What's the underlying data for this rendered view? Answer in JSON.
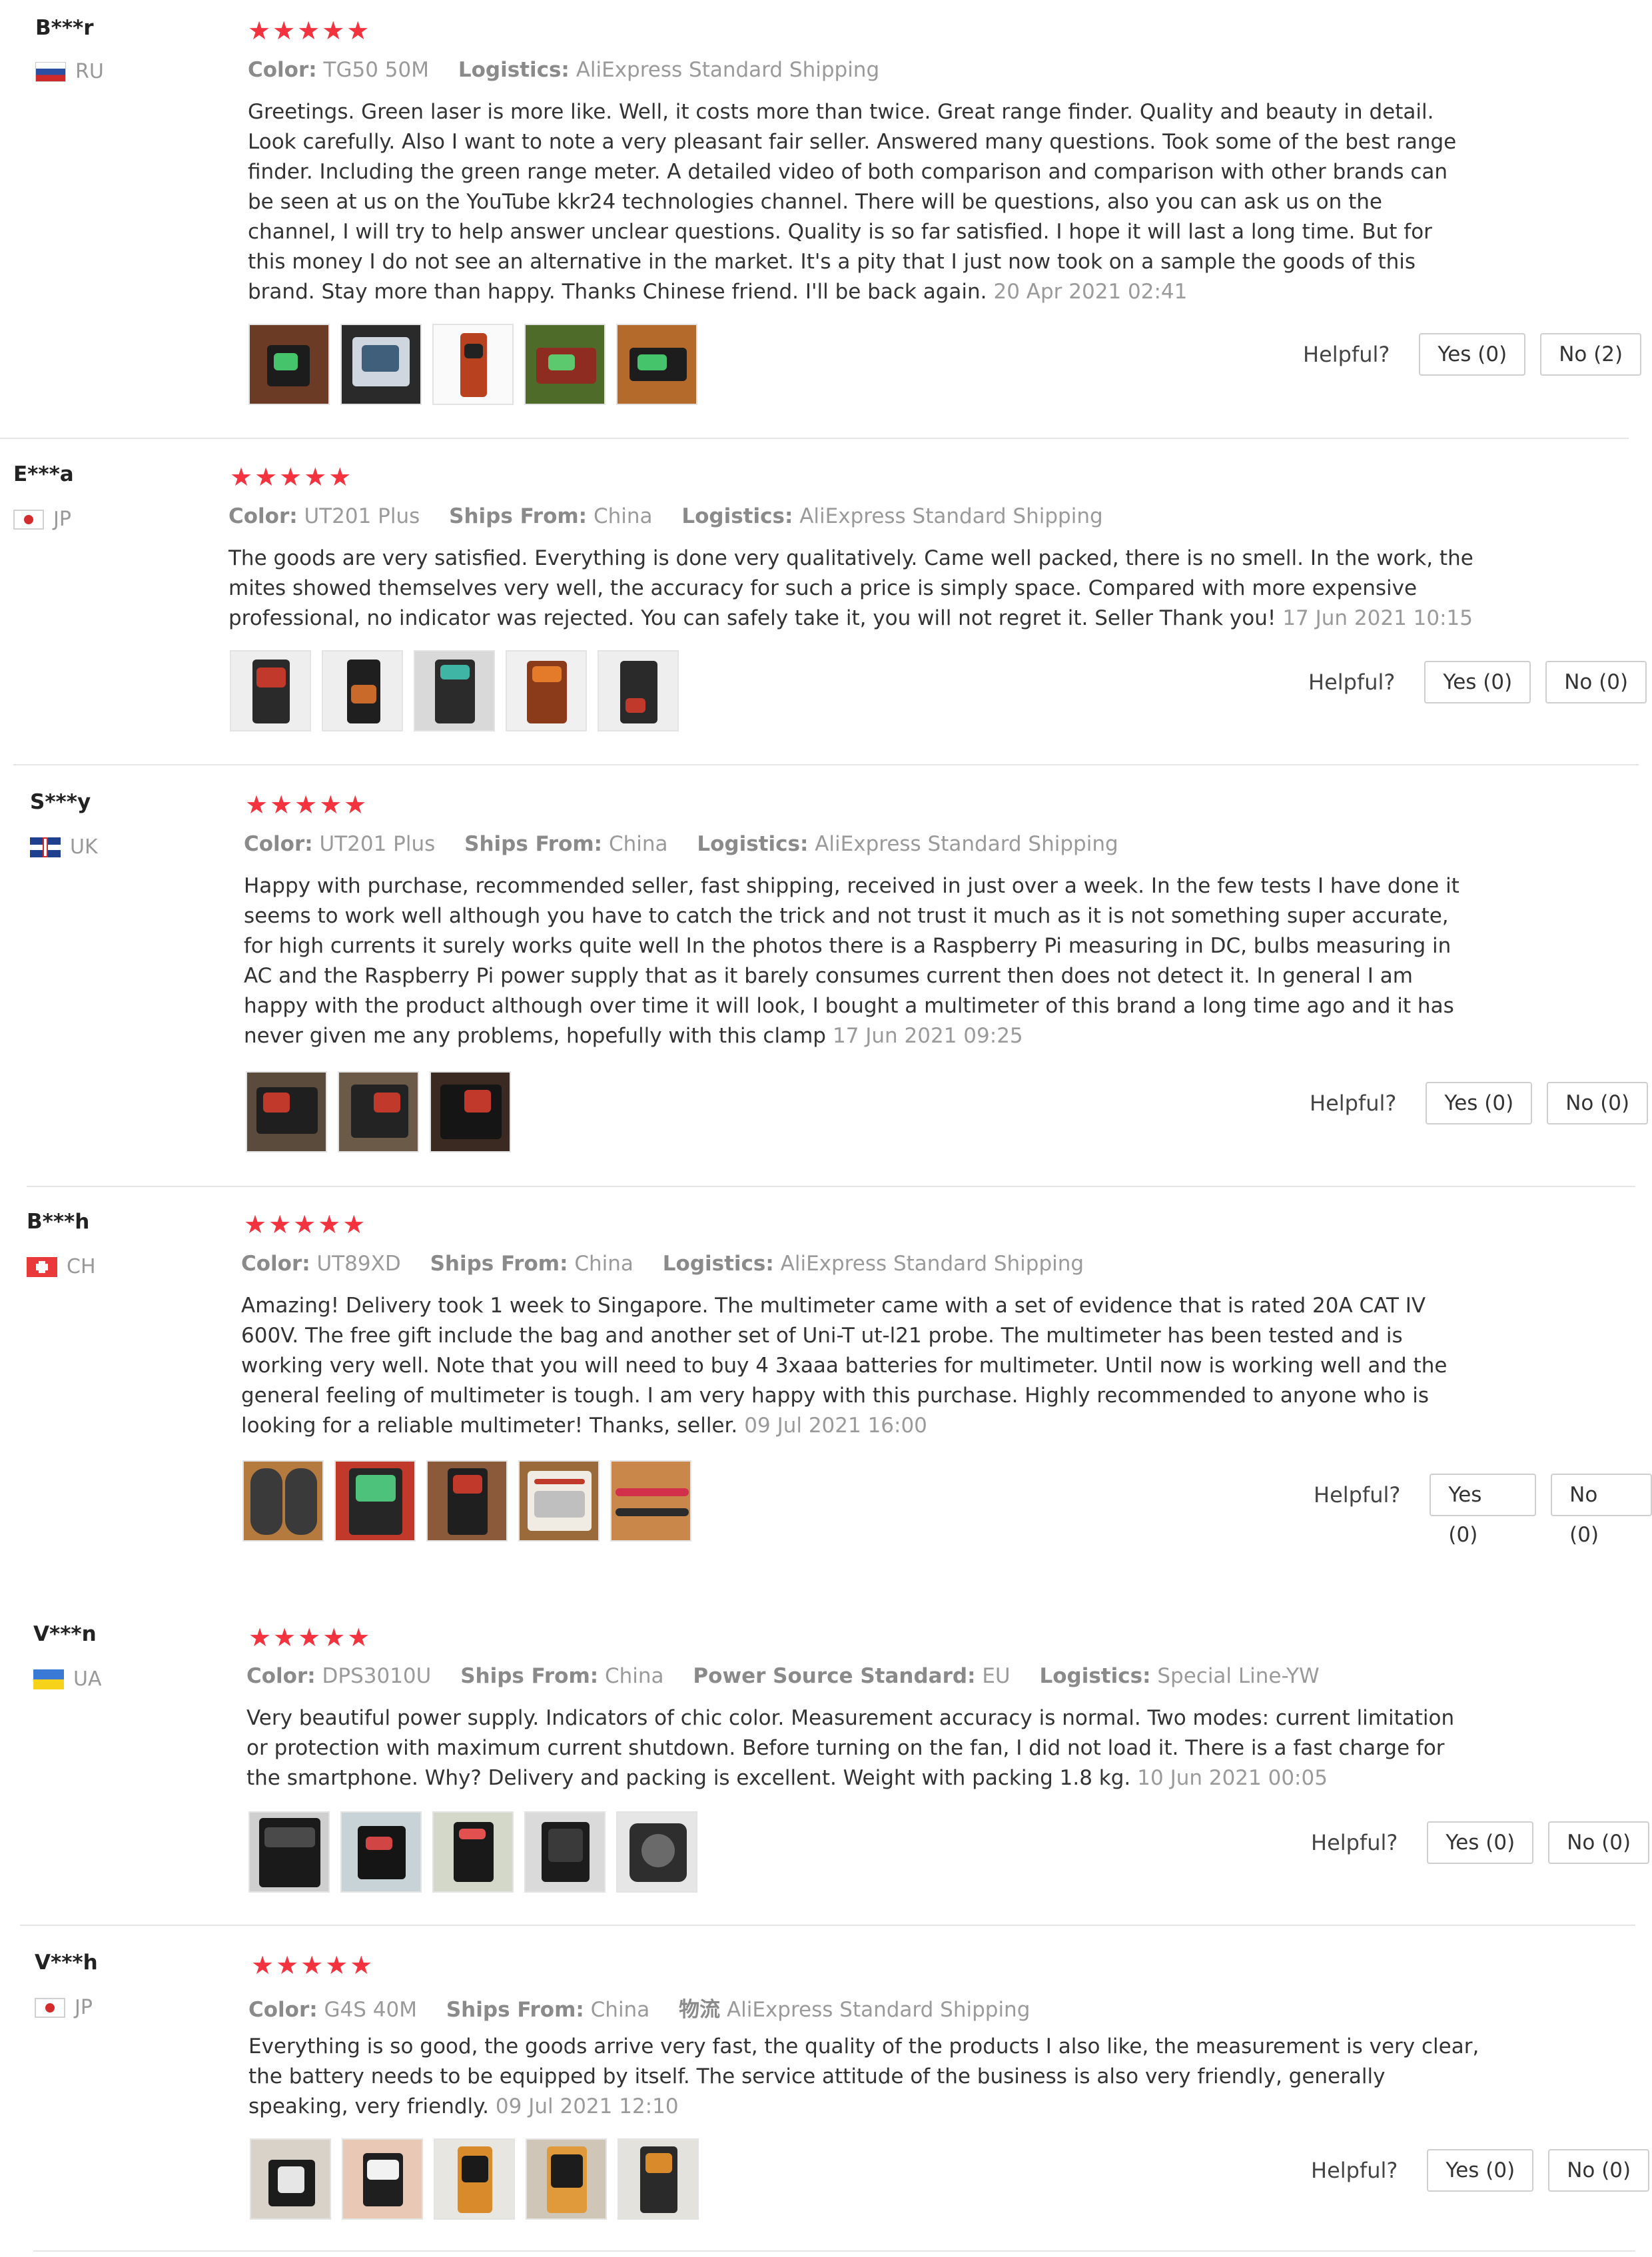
{
  "reviews": [
    {
      "user": "B***r",
      "country": "RU",
      "stars": "★★★★★",
      "meta": [
        {
          "label": "Color:",
          "value": "TG50 50M"
        },
        {
          "label": "Logistics:",
          "value": "AliExpress Standard Shipping"
        }
      ],
      "text": "Greetings. Green laser is more like. Well, it costs more than twice. Great range finder. Quality and beauty in detail. Look carefully. Also I want to note a very pleasant fair seller. Answered many questions. Took some of the best range finder. Including the green range meter. A detailed video of both comparison and comparison with other brands can be seen at us on the YouTube kkr24 technologies channel. There will be questions, also you can ask us on the channel, I will try to help answer unclear questions. Quality is so far satisfied. I hope it will last a long time. But for this money I do not see an alternative in the market. It's a pity that I just now took on a sample the goods of this brand. Stay more than happy. Thanks Chinese friend. I'll be back again.",
      "date": "20 Apr 2021 02:41",
      "helpful_label": "Helpful?",
      "yes": "Yes (0)",
      "no": "No (2)"
    },
    {
      "user": "E***a",
      "country": "JP",
      "stars": "★★★★★",
      "meta": [
        {
          "label": "Color:",
          "value": "UT201 Plus"
        },
        {
          "label": "Ships From:",
          "value": "China"
        },
        {
          "label": "Logistics:",
          "value": "AliExpress Standard Shipping"
        }
      ],
      "text": "The goods are very satisfied. Everything is done very qualitatively. Came well packed, there is no smell. In the work, the mites showed themselves very well, the accuracy for such a price is simply space. Compared with more expensive professional, no indicator was rejected. You can safely take it, you will not regret it. Seller Thank you!",
      "date": "17 Jun 2021 10:15",
      "helpful_label": "Helpful?",
      "yes": "Yes (0)",
      "no": "No (0)"
    },
    {
      "user": "S***y",
      "country": "UK",
      "stars": "★★★★★",
      "meta": [
        {
          "label": "Color:",
          "value": "UT201 Plus"
        },
        {
          "label": "Ships From:",
          "value": "China"
        },
        {
          "label": "Logistics:",
          "value": "AliExpress Standard Shipping"
        }
      ],
      "text": "Happy with purchase, recommended seller, fast shipping, received in just over a week. In the few tests I have done it seems to work well although you have to catch the trick and not trust it much as it is not something super accurate, for high currents it surely works quite well In the photos there is a Raspberry Pi measuring in DC, bulbs measuring in AC and the Raspberry Pi power supply that as it barely consumes current then does not detect it. In general I am happy with the product although over time it will look, I bought a multimeter of this brand a long time ago and it has never given me any problems, hopefully with this clamp",
      "date": "17 Jun 2021 09:25",
      "helpful_label": "Helpful?",
      "yes": "Yes (0)",
      "no": "No (0)"
    },
    {
      "user": "B***h",
      "country": "CH",
      "stars": "★★★★★",
      "meta": [
        {
          "label": "Color:",
          "value": "UT89XD"
        },
        {
          "label": "Ships From:",
          "value": "China"
        },
        {
          "label": "Logistics:",
          "value": "AliExpress Standard Shipping"
        }
      ],
      "text": "Amazing! Delivery took 1 week to Singapore. The multimeter came with a set of evidence that is rated 20A CAT IV 600V. The free gift include the bag and another set of Uni-T ut-l21 probe. The multimeter has been tested and is working very well. Note that you will need to buy 4 3xaaa batteries for multimeter. Until now is working well and the general feeling of multimeter is tough. I am very happy with this purchase. Highly recommended to anyone who is looking for a reliable multimeter! Thanks, seller.",
      "date": "09 Jul 2021 16:00",
      "helpful_label": "Helpful?",
      "yes": "Yes (0)",
      "no": "No (0)"
    },
    {
      "user": "V***n",
      "country": "UA",
      "stars": "★★★★★",
      "meta": [
        {
          "label": "Color:",
          "value": "DPS3010U"
        },
        {
          "label": "Ships From:",
          "value": "China"
        },
        {
          "label": "Power Source Standard:",
          "value": "EU"
        },
        {
          "label": "Logistics:",
          "value": "Special Line-YW"
        }
      ],
      "text": "Very beautiful power supply. Indicators of chic color. Measurement accuracy is normal. Two modes: current limitation or protection with maximum current shutdown. Before turning on the fan, I did not load it. There is a fast charge for the smartphone. Why? Delivery and packing is excellent. Weight with packing 1.8 kg.",
      "date": "10 Jun 2021 00:05",
      "helpful_label": "Helpful?",
      "yes": "Yes (0)",
      "no": "No (0)"
    },
    {
      "user": "V***h",
      "country": "JP",
      "stars": "★★★★★",
      "meta": [
        {
          "label": "Color:",
          "value": "G4S 40M"
        },
        {
          "label": "Ships From:",
          "value": "China"
        },
        {
          "label": "物流",
          "value": "AliExpress Standard Shipping"
        }
      ],
      "text": "Everything is so good, the goods arrive very fast, the quality of the products I also like, the measurement is very clear, the battery needs to be equipped by itself. The service attitude of the business is also very friendly, generally speaking, very friendly.",
      "date": "09 Jul 2021 12:10",
      "helpful_label": "Helpful?",
      "yes": "Yes (0)",
      "no": "No (0)"
    }
  ],
  "colors": {
    "star": "#f5333f",
    "muted": "#9a9a9a",
    "text": "#333333",
    "divider": "#e6e6e6"
  }
}
